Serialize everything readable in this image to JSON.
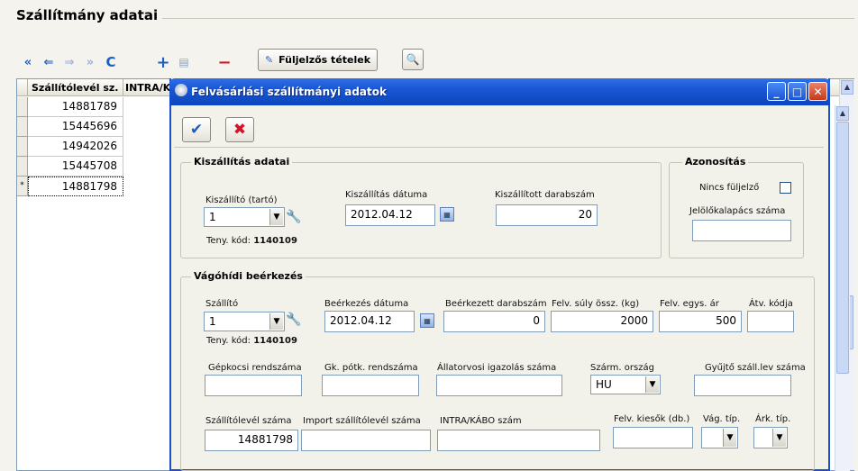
{
  "panel": {
    "title": "Szállítmány adatai"
  },
  "toolbar": {
    "first_btn": "«",
    "prev_btn": "⇐",
    "next_btn": "⇒",
    "last_btn": "»",
    "refresh_btn": "C",
    "add_btn": "+",
    "doc_btn": "▤",
    "remove_btn": "−",
    "ear_tag_label": "Füljelzős tételek",
    "search_btn": "🔍"
  },
  "grid": {
    "columns": [
      "Szállítólevél sz.",
      "INTRA/K"
    ],
    "rows": [
      "14881789",
      "15445696",
      "14942026",
      "15445708",
      "14881798"
    ],
    "current_row_marker": "*"
  },
  "dialog": {
    "title": "Felvásárlási szállítmányi adatok",
    "ok_icon": "✔",
    "cancel_icon": "✖",
    "minimize": "_",
    "maximize": "□",
    "close": "✕",
    "shipping": {
      "title": "Kiszállítás adatai",
      "supplier_label": "Kiszállító (tartó)",
      "supplier_value": "1",
      "herd_code_label": "Teny. kód:",
      "herd_code_value": "1140109",
      "date_label": "Kiszállítás dátuma",
      "date_value": "2012.04.12",
      "count_label": "Kiszállított darabszám",
      "count_value": "20"
    },
    "identification": {
      "title": "Azonosítás",
      "no_ear_tag_label": "Nincs füljelző",
      "no_ear_tag_checked": false,
      "hammer_label": "Jelölőkalapács száma",
      "hammer_value": ""
    },
    "arrival": {
      "title": "Vágóhídi beérkezés",
      "carrier_label": "Szállító",
      "carrier_value": "1",
      "herd_code_label": "Teny. kód:",
      "herd_code_value": "1140109",
      "date_label": "Beérkezés dátuma",
      "date_value": "2012.04.12",
      "count_label": "Beérkezett darabszám",
      "count_value": "0",
      "weight_label": "Felv. súly össz. (kg)",
      "weight_value": "2000",
      "price_label": "Felv. egys. ár",
      "price_value": "500",
      "transfer_label": "Átv. kódja",
      "transfer_value": "",
      "truck_label": "Gépkocsi rendszáma",
      "truck_value": "",
      "trailer_label": "Gk. pótk. rendszáma",
      "trailer_value": "",
      "vet_label": "Állatorvosi igazolás száma",
      "vet_value": "",
      "origin_label": "Szárm. ország",
      "origin_value": "HU",
      "collector_label": "Gyűjtő száll.lev száma",
      "collector_value": "",
      "waybill_label": "Szállítólevél száma",
      "waybill_value": "14881798",
      "import_label": "Import szállítólevél száma",
      "import_value": "",
      "intra_label": "INTRA/KÁBO szám",
      "intra_value": "",
      "losses_label": "Felv. kiesők (db.)",
      "losses_value": "",
      "slaughter_type_label": "Vág. típ.",
      "slaughter_type_value": "",
      "price_type_label": "Árk. típ.",
      "price_type_value": ""
    }
  },
  "colors": {
    "titlebar": "#1a56d4",
    "background": "#f4f3ee",
    "field_border": "#7f9db9",
    "close_button": "#c63a16"
  }
}
